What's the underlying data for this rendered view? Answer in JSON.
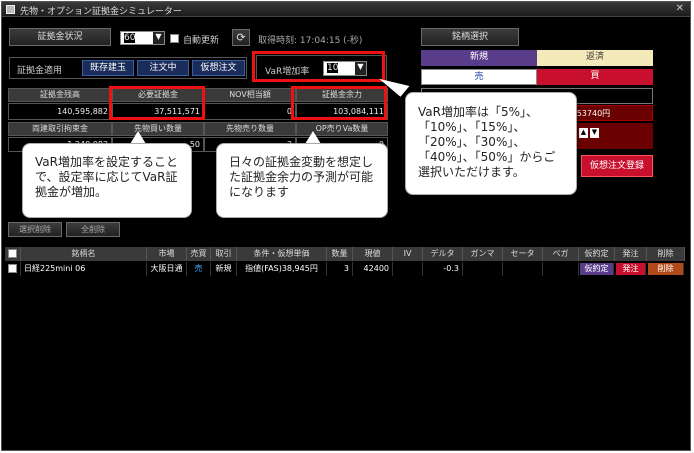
{
  "window": {
    "title": "先物・オプション証拠金シミュレーター",
    "close": "✕"
  },
  "top": {
    "status_button": "証拠金状況",
    "interval_value": "60",
    "auto_update_label": "自動更新",
    "fetch_time": "取得時刻: 17:04:15 (-秒)",
    "brand_select_button": "銘柄選択"
  },
  "apply": {
    "label": "証拠金適用",
    "buttons": [
      "既存建玉",
      "注文中",
      "仮想注文"
    ],
    "var_label": "VaR増加率",
    "var_value": "10"
  },
  "summary": {
    "headers1": [
      "証拠金残高",
      "必要証拠金",
      "NOV相当額",
      "証拠金余力"
    ],
    "values1": [
      "140,595,882",
      "37,511,571",
      "0",
      "103,084,111"
    ],
    "headers2": [
      "両建取引拘束金",
      "先物買い数量",
      "先物売り数量",
      "OP売りVa数量"
    ],
    "values2": [
      "1,240,083",
      "50",
      "3",
      "0"
    ]
  },
  "order": {
    "new": "新規",
    "close": "返済",
    "sell": "売",
    "buy": "買",
    "price_hint": "~53740円",
    "register_button": "仮想注文登録"
  },
  "list": {
    "select_delete": "選択削除",
    "delete_all": "全削除",
    "columns": [
      "銘柄名",
      "市場",
      "売買",
      "取引",
      "条件・仮想単価",
      "数量",
      "現値",
      "IV",
      "デルタ",
      "ガンマ",
      "セータ",
      "ベガ",
      "仮約定",
      "発注",
      "削除"
    ],
    "rows": [
      {
        "name": "日経225mini 06",
        "market": "大阪日通",
        "side": "売",
        "trade": "新規",
        "condition": "指値(FAS)38,945円",
        "qty": "3",
        "price": "42400",
        "iv": "",
        "delta": "-0.3",
        "gamma": "",
        "theta": "",
        "vega": "",
        "provisional": "仮約定",
        "order": "発注",
        "delete": "削除"
      }
    ]
  },
  "callouts": {
    "left": "VaR増加率を設定することで、設定率に応じてVaR証拠金が増加。",
    "middle": "日々の証拠金変動を想定した証拠金余力の予測が可能になります",
    "right": "VaR増加率は「5%」、「10%」、「15%」、「20%」、「30%」、「40%」、「50%」からご選択いただけます。"
  },
  "colors": {
    "accent_red": "#e11111",
    "buy_red": "#c8102e",
    "sell_blue": "#2244aa",
    "new_purple": "#5a3d8a",
    "close_yellow": "#f4e9b8"
  }
}
